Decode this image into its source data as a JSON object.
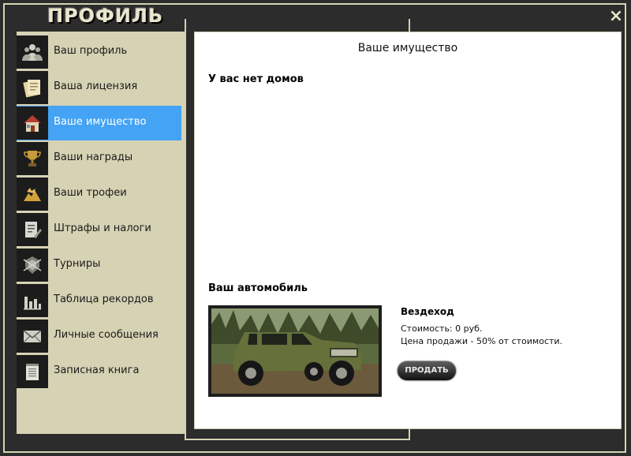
{
  "window": {
    "title": "ПРОФИЛЬ",
    "close_label": "×"
  },
  "sidebar": {
    "items": [
      {
        "label": "Ваш профиль",
        "icon": "users-icon",
        "active": false
      },
      {
        "label": "Ваша лицензия",
        "icon": "documents-icon",
        "active": false
      },
      {
        "label": "Ваше имущество",
        "icon": "house-icon",
        "active": true
      },
      {
        "label": "Ваши награды",
        "icon": "trophy-icon",
        "active": false
      },
      {
        "label": "Ваши трофеи",
        "icon": "trophy-heap-icon",
        "active": false
      },
      {
        "label": "Штрафы и налоги",
        "icon": "fines-document-icon",
        "active": false
      },
      {
        "label": "Турниры",
        "icon": "tournament-emblem-icon",
        "active": false
      },
      {
        "label": "Таблица рекордов",
        "icon": "bar-chart-icon",
        "active": false
      },
      {
        "label": "Личные сообщения",
        "icon": "envelope-icon",
        "active": false
      },
      {
        "label": "Записная книга",
        "icon": "notebook-icon",
        "active": false
      }
    ]
  },
  "content": {
    "title": "Ваше имущество",
    "houses_heading": "У вас нет домов",
    "car_heading": "Ваш автомобиль",
    "car": {
      "name": "Вездеход",
      "cost": "Стоимость: 0 руб.",
      "sale_price": "Цена продажи - 50% от стоимости.",
      "sell_label": "ПРОДАТЬ"
    }
  },
  "colors": {
    "accent": "#44a3f4",
    "sidebar_bg": "#d6d2b4",
    "frame_bg": "#2b2c2b"
  }
}
